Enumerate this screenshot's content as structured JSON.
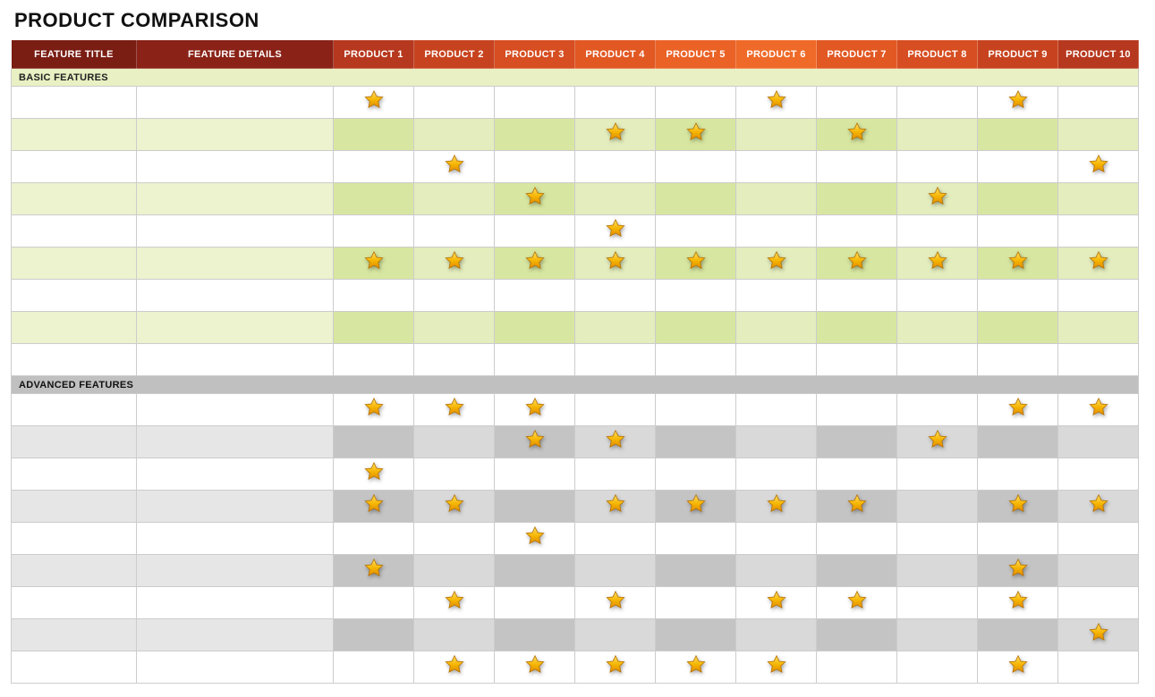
{
  "title": "PRODUCT COMPARISON",
  "headers": {
    "feature_title": "FEATURE TITLE",
    "feature_details": "FEATURE DETAILS",
    "products": [
      "PRODUCT 1",
      "PRODUCT 2",
      "PRODUCT 3",
      "PRODUCT 4",
      "PRODUCT 5",
      "PRODUCT 6",
      "PRODUCT 7",
      "PRODUCT 8",
      "PRODUCT 9",
      "PRODUCT 10"
    ]
  },
  "sections": {
    "basic_label": "BASIC FEATURES",
    "advanced_label": "ADVANCED FEATURES"
  },
  "chart_data": {
    "type": "table",
    "title": "PRODUCT COMPARISON",
    "legend": "star = feature present",
    "columns": [
      "PRODUCT 1",
      "PRODUCT 2",
      "PRODUCT 3",
      "PRODUCT 4",
      "PRODUCT 5",
      "PRODUCT 6",
      "PRODUCT 7",
      "PRODUCT 8",
      "PRODUCT 9",
      "PRODUCT 10"
    ],
    "sections": [
      {
        "name": "BASIC FEATURES",
        "rows": [
          [
            1,
            0,
            0,
            0,
            0,
            1,
            0,
            0,
            1,
            0
          ],
          [
            0,
            0,
            0,
            1,
            1,
            0,
            1,
            0,
            0,
            0
          ],
          [
            0,
            1,
            0,
            0,
            0,
            0,
            0,
            0,
            0,
            1
          ],
          [
            0,
            0,
            1,
            0,
            0,
            0,
            0,
            1,
            0,
            0
          ],
          [
            0,
            0,
            0,
            1,
            0,
            0,
            0,
            0,
            0,
            0
          ],
          [
            1,
            1,
            1,
            1,
            1,
            1,
            1,
            1,
            1,
            1
          ],
          [
            0,
            0,
            0,
            0,
            0,
            0,
            0,
            0,
            0,
            0
          ],
          [
            0,
            0,
            0,
            0,
            0,
            0,
            0,
            0,
            0,
            0
          ],
          [
            0,
            0,
            0,
            0,
            0,
            0,
            0,
            0,
            0,
            0
          ]
        ]
      },
      {
        "name": "ADVANCED FEATURES",
        "rows": [
          [
            1,
            1,
            1,
            0,
            0,
            0,
            0,
            0,
            1,
            1
          ],
          [
            0,
            0,
            1,
            1,
            0,
            0,
            0,
            1,
            0,
            0
          ],
          [
            1,
            0,
            0,
            0,
            0,
            0,
            0,
            0,
            0,
            0
          ],
          [
            1,
            1,
            0,
            1,
            1,
            1,
            1,
            0,
            1,
            1
          ],
          [
            0,
            0,
            1,
            0,
            0,
            0,
            0,
            0,
            0,
            0
          ],
          [
            1,
            0,
            0,
            0,
            0,
            0,
            0,
            0,
            1,
            0
          ],
          [
            0,
            1,
            0,
            1,
            0,
            1,
            1,
            0,
            1,
            0
          ],
          [
            0,
            0,
            0,
            0,
            0,
            0,
            0,
            0,
            0,
            1
          ],
          [
            0,
            1,
            1,
            1,
            1,
            1,
            0,
            0,
            1,
            0
          ]
        ]
      }
    ]
  }
}
